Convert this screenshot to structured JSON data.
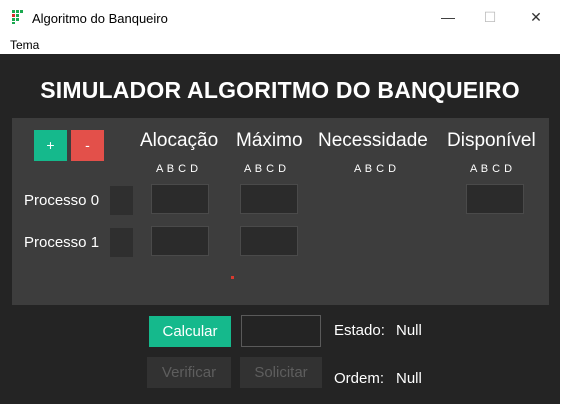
{
  "window": {
    "title": "Algoritmo do Banqueiro",
    "minimize": "—",
    "maximize": "☐",
    "close": "✕"
  },
  "menu": {
    "items": [
      "Tema"
    ]
  },
  "main": {
    "heading": "SIMULADOR ALGORITMO DO BANQUEIRO",
    "add_label": "+",
    "remove_label": "-",
    "columns": [
      {
        "title": "Alocação",
        "sub": "A B C D"
      },
      {
        "title": "Máximo",
        "sub": "A B C D"
      },
      {
        "title": "Necessidade",
        "sub": "A B C D"
      },
      {
        "title": "Disponível",
        "sub": "A B C D"
      }
    ],
    "processes": [
      {
        "label": "Processo 0"
      },
      {
        "label": "Processo 1"
      }
    ]
  },
  "controls": {
    "calcular": "Calcular",
    "verificar": "Verificar",
    "solicitar": "Solicitar",
    "input_value": "",
    "estado_label": "Estado:",
    "estado_value": "Null",
    "ordem_label": "Ordem:",
    "ordem_value": "Null"
  },
  "colors": {
    "accent_green": "#15b98c",
    "accent_red": "#e3504a",
    "background": "#242424",
    "panel": "#3d3d3d"
  }
}
